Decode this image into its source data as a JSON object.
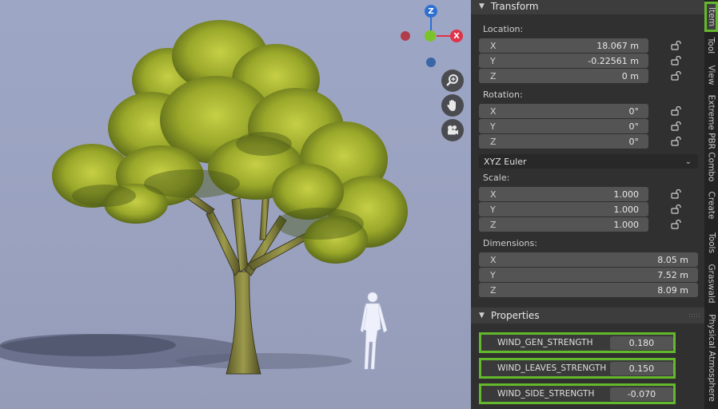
{
  "gizmo": {
    "z_label": "Z",
    "x_label": "X",
    "colors": {
      "z": "#2e6fd2",
      "x": "#e03348",
      "y": "#7bc32a",
      "neg_x": "#b03c4c",
      "neg_z": "#3a66a6"
    }
  },
  "nav_buttons": [
    {
      "name": "zoom-icon"
    },
    {
      "name": "hand-pan-icon"
    },
    {
      "name": "camera-icon"
    }
  ],
  "transform": {
    "header": "Transform",
    "location_label": "Location:",
    "location": [
      {
        "axis": "X",
        "value": "18.067 m"
      },
      {
        "axis": "Y",
        "value": "-0.22561 m"
      },
      {
        "axis": "Z",
        "value": "0 m"
      }
    ],
    "rotation_label": "Rotation:",
    "rotation": [
      {
        "axis": "X",
        "value": "0°"
      },
      {
        "axis": "Y",
        "value": "0°"
      },
      {
        "axis": "Z",
        "value": "0°"
      }
    ],
    "rotation_mode": "XYZ Euler",
    "scale_label": "Scale:",
    "scale": [
      {
        "axis": "X",
        "value": "1.000"
      },
      {
        "axis": "Y",
        "value": "1.000"
      },
      {
        "axis": "Z",
        "value": "1.000"
      }
    ],
    "dimensions_label": "Dimensions:",
    "dimensions": [
      {
        "axis": "X",
        "value": "8.05 m"
      },
      {
        "axis": "Y",
        "value": "7.52 m"
      },
      {
        "axis": "Z",
        "value": "8.09 m"
      }
    ]
  },
  "properties": {
    "header": "Properties",
    "rows": [
      {
        "name": "WIND_GEN_STRENGTH",
        "value": "0.180"
      },
      {
        "name": "WIND_LEAVES_STRENGTH",
        "value": "0.150"
      },
      {
        "name": "WIND_SIDE_STRENGTH",
        "value": "-0.070"
      }
    ]
  },
  "tabs": [
    "Item",
    "Tool",
    "View",
    "Extreme PBR Combo",
    "Create",
    "Tools",
    "Graswald",
    "Physical Atmosphere"
  ],
  "active_tab": "Item",
  "highlight_color": "#64b82c"
}
